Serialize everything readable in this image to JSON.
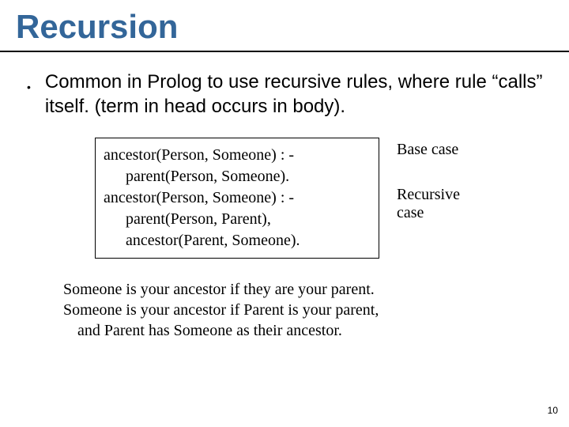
{
  "title": "Recursion",
  "bullet": "Common in Prolog to use recursive rules, where rule “calls” itself. (term in head occurs in body).",
  "code": {
    "l1": "ancestor(Person, Someone) : -",
    "l2": "parent(Person, Someone).",
    "l3": "ancestor(Person, Someone) : -",
    "l4": "parent(Person, Parent),",
    "l5": "ancestor(Parent, Someone)."
  },
  "annot": {
    "base": "Base case",
    "rec1": "Recursive",
    "rec2": "case"
  },
  "explain": {
    "l1": "Someone is your ancestor if they are your parent.",
    "l2": "Someone is your ancestor if Parent is your parent,",
    "l3": "and Parent has Someone as their ancestor."
  },
  "page": "10"
}
